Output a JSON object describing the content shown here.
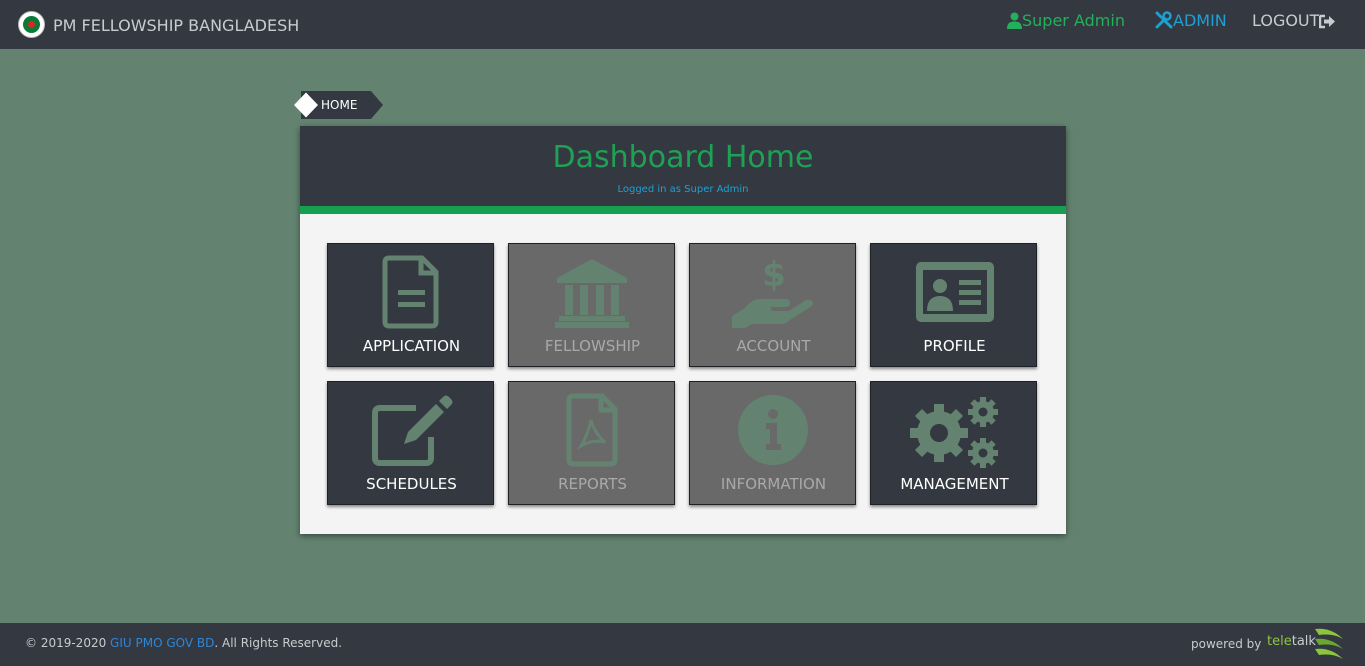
{
  "header": {
    "brand": "PM FELLOWSHIP BANGLADESH",
    "user": "Super Admin",
    "admin": "ADMIN",
    "logout": "LOGOUT"
  },
  "breadcrumb": {
    "home": "HOME"
  },
  "dashboard": {
    "title": "Dashboard Home",
    "subtitle": "Logged in as Super Admin",
    "tiles": [
      {
        "label": "APPLICATION",
        "icon": "file-icon",
        "state": "active"
      },
      {
        "label": "FELLOWSHIP",
        "icon": "bank-icon",
        "state": "disabled"
      },
      {
        "label": "ACCOUNT",
        "icon": "hand-dollar-icon",
        "state": "disabled"
      },
      {
        "label": "PROFILE",
        "icon": "id-card-icon",
        "state": "active"
      },
      {
        "label": "SCHEDULES",
        "icon": "edit-icon",
        "state": "active"
      },
      {
        "label": "REPORTS",
        "icon": "pdf-file-icon",
        "state": "disabled"
      },
      {
        "label": "INFORMATION",
        "icon": "info-circle-icon",
        "state": "disabled"
      },
      {
        "label": "MANAGEMENT",
        "icon": "gears-icon",
        "state": "active"
      }
    ]
  },
  "footer": {
    "copyright_prefix": "© 2019-2020 ",
    "copyright_link": "GIU PMO GOV BD",
    "copyright_suffix": ". All Rights Reserved.",
    "powered_by": "powered by",
    "logo_tele": "tele",
    "logo_talk": "talk"
  },
  "colors": {
    "background": "#638370",
    "bar": "#343840",
    "accent_green": "#1ea154",
    "accent_blue": "#1fa0d2",
    "tile_active": "#343840",
    "tile_disabled": "#696969",
    "icon": "#638370"
  }
}
